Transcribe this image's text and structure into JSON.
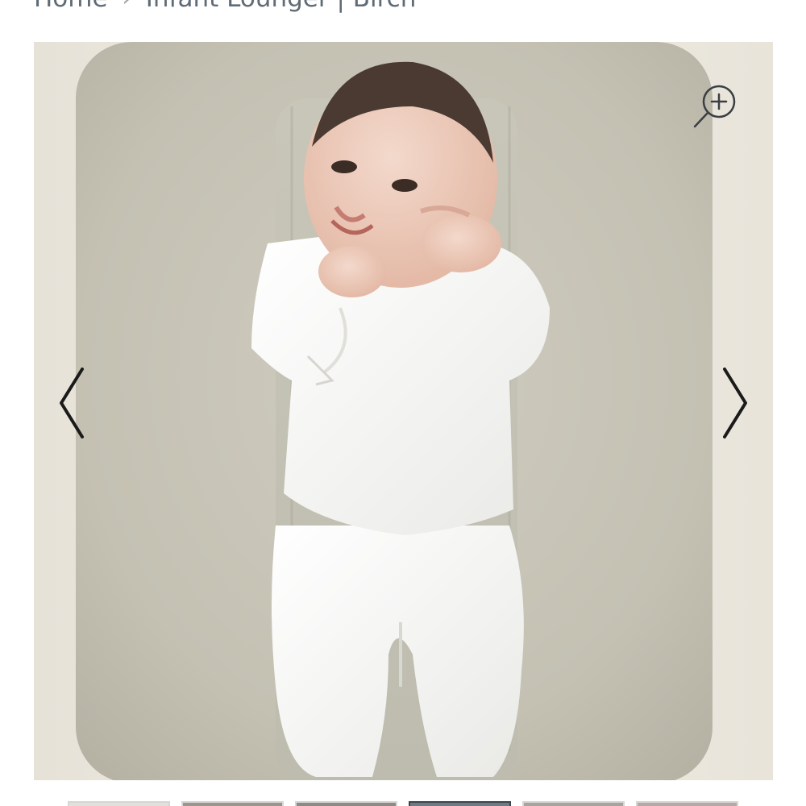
{
  "breadcrumb": {
    "home_label": "Home",
    "separator": "›",
    "current_label": "Infant Lounger | Birch"
  },
  "gallery": {
    "zoom_icon": "zoom-in-icon",
    "prev_icon": "chevron-left-icon",
    "next_icon": "chevron-right-icon",
    "thumbnail_count": 6,
    "active_thumbnail_index": 3
  },
  "colors": {
    "breadcrumb_text": "#5f6b76",
    "lounger": "#c9c6b8",
    "background_wall": "#ece8df",
    "arrow": "#1a1a1a"
  }
}
